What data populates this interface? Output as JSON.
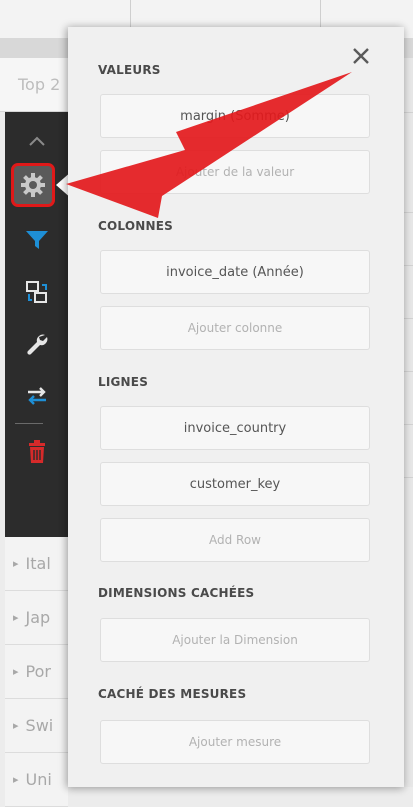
{
  "background": {
    "top_tab_text": "Top 2"
  },
  "rows": [
    {
      "label": "Ital"
    },
    {
      "label": "Jap"
    },
    {
      "label": "Por"
    },
    {
      "label": "Swi"
    },
    {
      "label": "Uni"
    }
  ],
  "panel": {
    "close_label": "✕",
    "sections": {
      "values": {
        "title": "VALEURS",
        "items": [
          "margin (Somme)"
        ],
        "placeholder": "Ajouter de la valeur"
      },
      "columns": {
        "title": "COLONNES",
        "items": [
          "invoice_date (Année)"
        ],
        "placeholder": "Ajouter colonne"
      },
      "rows": {
        "title": "LIGNES",
        "items": [
          "invoice_country",
          "customer_key"
        ],
        "placeholder": "Add Row"
      },
      "hidden_dimensions": {
        "title": "DIMENSIONS CACHÉES",
        "placeholder": "Ajouter la Dimension"
      },
      "hidden_measures": {
        "title": "CACHÉ DES MESURES",
        "placeholder": "Ajouter mesure"
      }
    }
  },
  "toolbar": {
    "icons": [
      "chevron-up-icon",
      "gear-icon",
      "filter-icon",
      "swap-layout-icon",
      "wrench-icon",
      "transpose-icon",
      "trash-icon"
    ]
  },
  "colors": {
    "toolbar_bg": "#2c2c2c",
    "accent_blue": "#1e8fd6",
    "danger_red": "#e01919",
    "annotation_red": "#e3191c"
  }
}
